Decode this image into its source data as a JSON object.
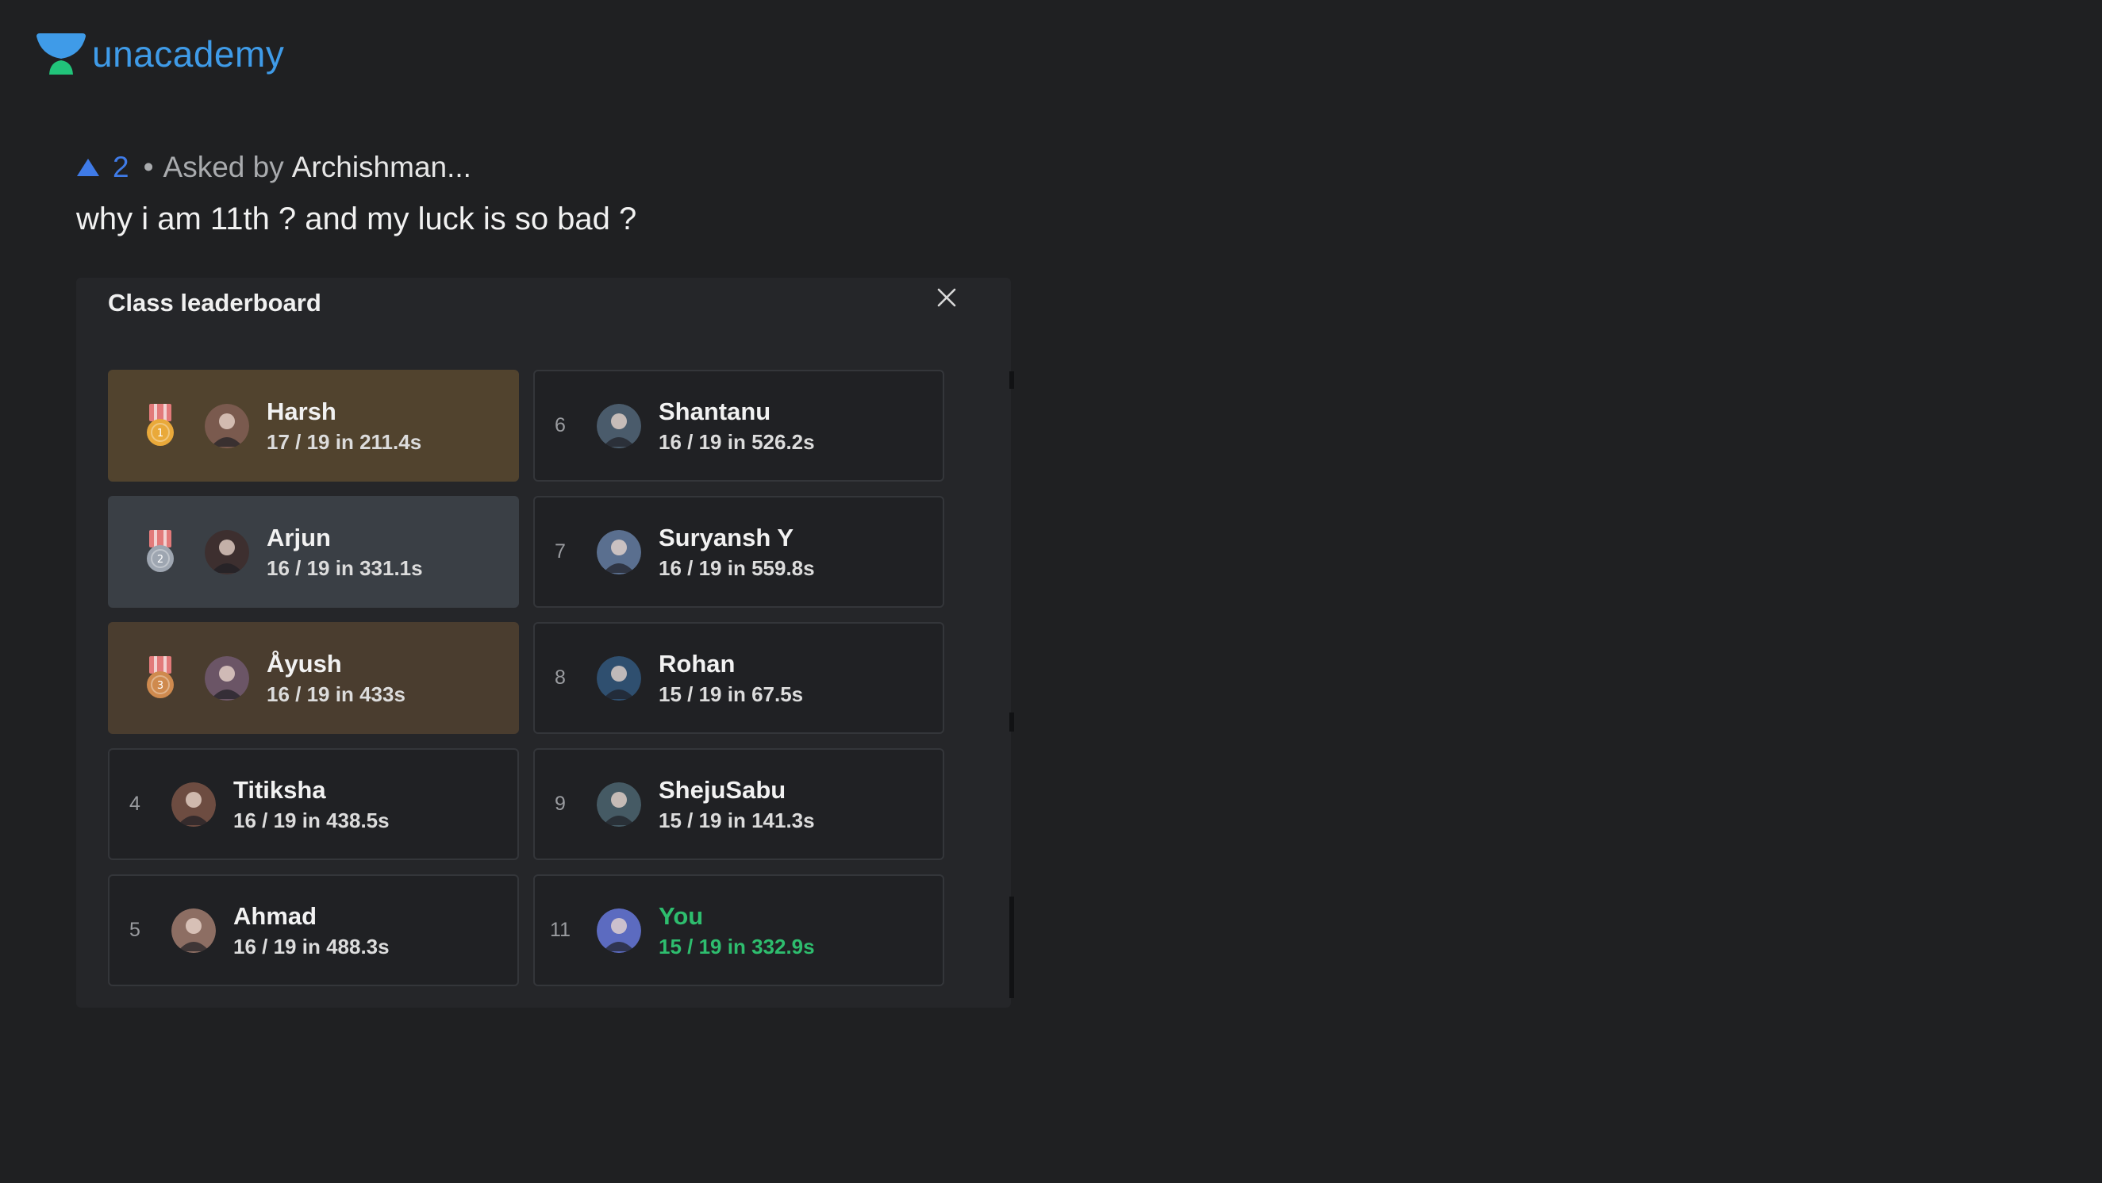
{
  "brand": {
    "name": "unacademy",
    "color": "#3f9be8",
    "icon": "graduation-cap-icon"
  },
  "question": {
    "upvotes": "2",
    "upvote_icon": "upvote-arrow-icon",
    "separator": "•",
    "asked_by_label": "Asked by",
    "asker": "Archishman...",
    "text": "why i am 11th ? and my luck is so bad ?"
  },
  "leaderboard": {
    "title": "Class leaderboard",
    "close_icon": "close-icon",
    "entries": [
      {
        "rank": "1",
        "name": "Harsh",
        "score": "17 / 19 in 211.4s",
        "medal": "gold"
      },
      {
        "rank": "6",
        "name": "Shantanu",
        "score": "16 / 19 in 526.2s"
      },
      {
        "rank": "2",
        "name": "Arjun",
        "score": "16 / 19 in 331.1s",
        "medal": "silver"
      },
      {
        "rank": "7",
        "name": "Suryansh Y",
        "score": "16 / 19 in 559.8s"
      },
      {
        "rank": "3",
        "name": "Åyush",
        "score": "16 / 19 in 433s",
        "medal": "bronze"
      },
      {
        "rank": "8",
        "name": "Rohan",
        "score": "15 / 19 in 67.5s"
      },
      {
        "rank": "4",
        "name": "Titiksha",
        "score": "16 / 19 in 438.5s"
      },
      {
        "rank": "9",
        "name": "ShejuSabu",
        "score": "15 / 19 in 141.3s"
      },
      {
        "rank": "5",
        "name": "Ahmad",
        "score": "16 / 19 in 488.3s"
      },
      {
        "rank": "11",
        "name": "You",
        "score": "15 / 19 in 332.9s",
        "is_current_user": true
      }
    ]
  },
  "colors": {
    "background": "#1f2022",
    "panel": "#252629",
    "gold_card": "#51432e",
    "silver_card": "#3a3f45",
    "bronze_card": "#4a3d2f",
    "you_highlight": "#2ebd6e",
    "upvote": "#3f7be8"
  }
}
